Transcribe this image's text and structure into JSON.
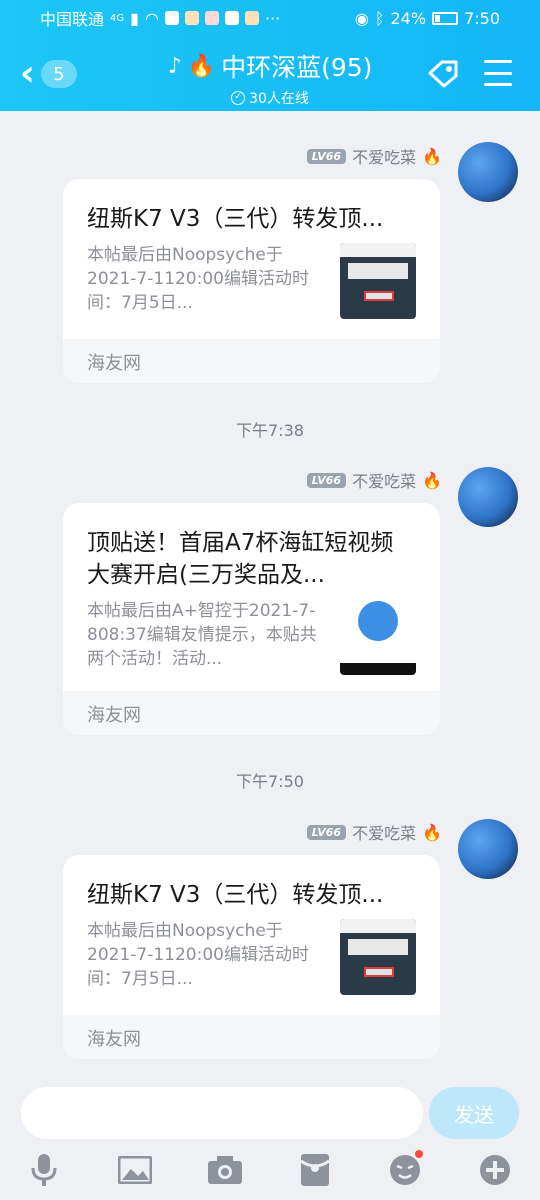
{
  "status_bar": {
    "carrier": "中国联通",
    "network": "4G",
    "battery": "24%",
    "time": "7:50"
  },
  "header": {
    "back_count": "5",
    "title": "中环深蓝(95)",
    "online": "30人在线"
  },
  "messages": [
    {
      "sender_level": "LV66",
      "sender_name": "不爱吃菜",
      "title": "纽斯K7 V3（三代）转发顶...",
      "desc": "本帖最后由Noopsyche于2021-7-1120:00编辑活动时间：7月5日...",
      "source": "海友网",
      "thumb": "product"
    },
    {
      "sender_level": "LV66",
      "sender_name": "不爱吃菜",
      "title": "顶贴送！首届A7杯海缸短视频大赛开启(三万奖品及...",
      "desc": "本帖最后由A+智控于2021-7-808:37编辑友情提示，本贴共两个活动！活动...",
      "source": "海友网",
      "thumb": "qr"
    },
    {
      "sender_level": "LV66",
      "sender_name": "不爱吃菜",
      "title": "纽斯K7 V3（三代）转发顶...",
      "desc": "本帖最后由Noopsyche于2021-7-1120:00编辑活动时间：7月5日...",
      "source": "海友网",
      "thumb": "product"
    }
  ],
  "timestamps": [
    "下午7:38",
    "下午7:50"
  ],
  "composer": {
    "send_label": "发送"
  },
  "toolbar": {
    "icons": [
      "microphone-icon",
      "image-icon",
      "camera-icon",
      "red-packet-icon",
      "emoji-icon",
      "plus-icon"
    ]
  },
  "colors": {
    "header": "#14b6f7",
    "send_button": "#bde8fb",
    "notification_dot": "#ff4a3b"
  }
}
